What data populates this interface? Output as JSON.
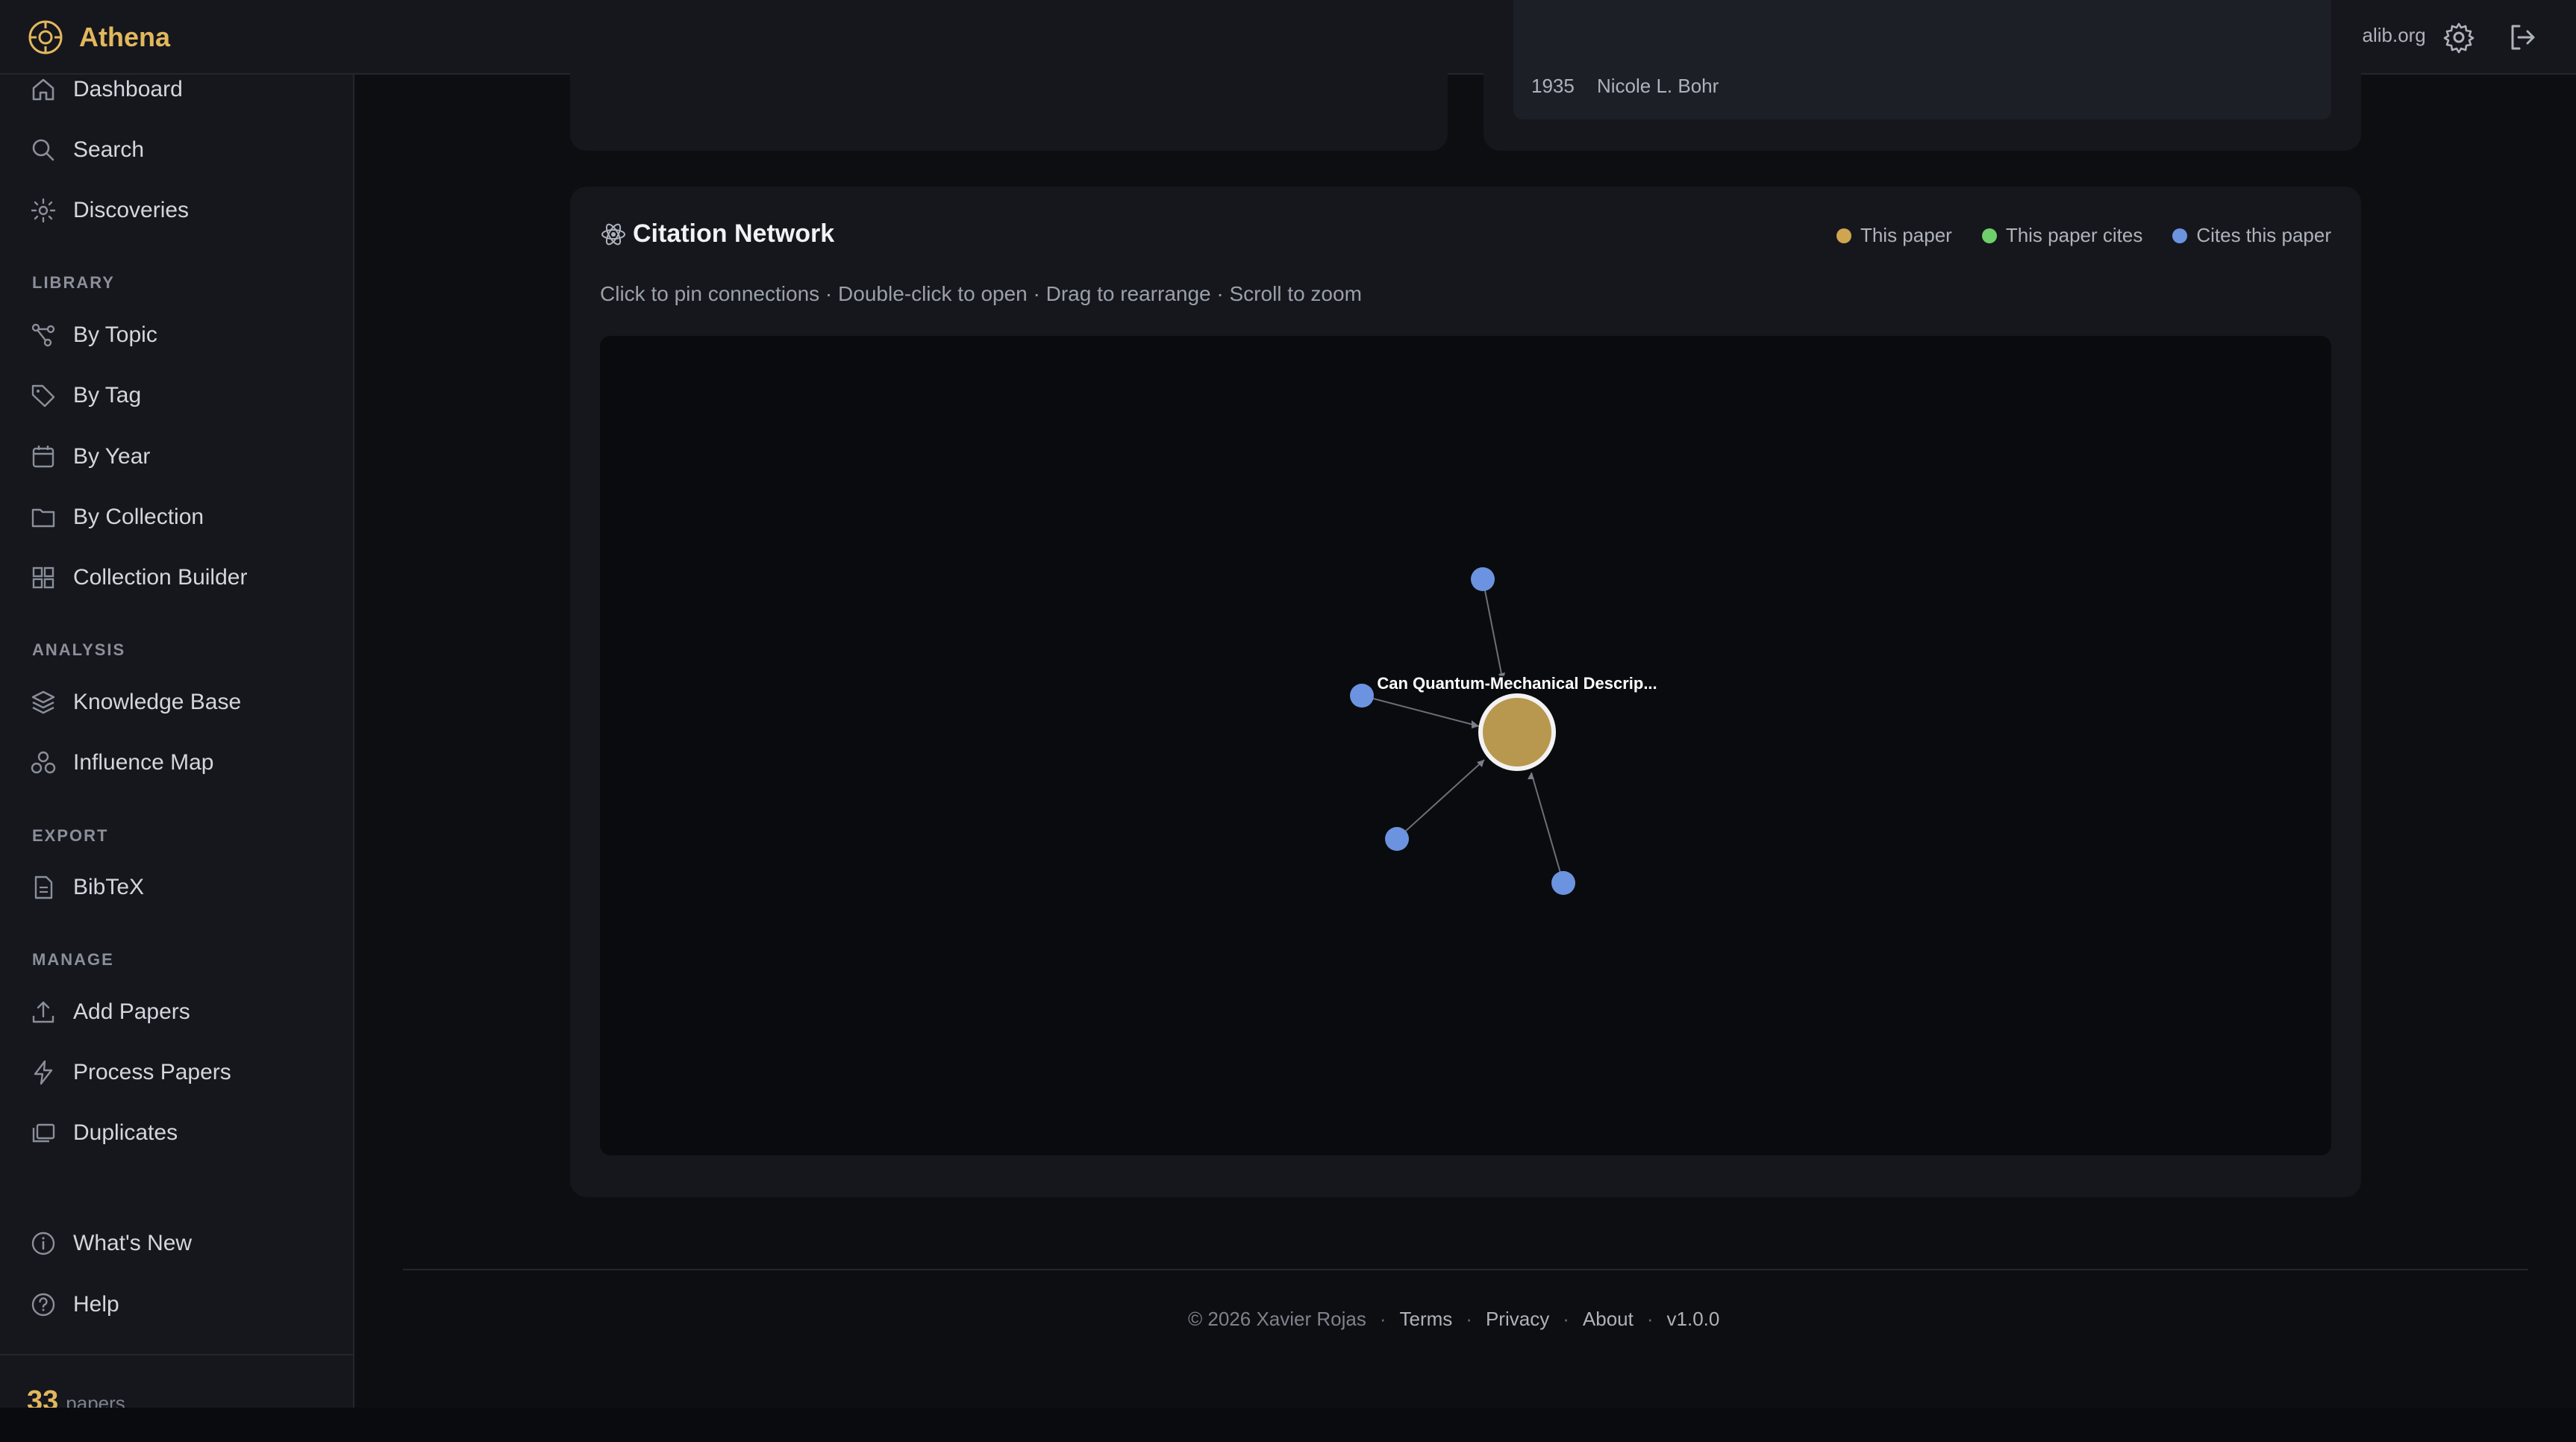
{
  "app": {
    "name": "Athena",
    "accent": "#e2b75d"
  },
  "topbar": {
    "user_email": "demo@athenalib.org"
  },
  "sidebar": {
    "main_items": [
      {
        "label": "Dashboard",
        "icon": "home-icon"
      },
      {
        "label": "Search",
        "icon": "search-icon"
      },
      {
        "label": "Discoveries",
        "icon": "sparkle-icon"
      }
    ],
    "sections": [
      {
        "title": "LIBRARY",
        "items": [
          {
            "label": "By Topic",
            "icon": "topic-graph-icon"
          },
          {
            "label": "By Tag",
            "icon": "tag-icon"
          },
          {
            "label": "By Year",
            "icon": "calendar-icon"
          },
          {
            "label": "By Collection",
            "icon": "folder-icon"
          },
          {
            "label": "Collection Builder",
            "icon": "grid-icon"
          }
        ]
      },
      {
        "title": "ANALYSIS",
        "items": [
          {
            "label": "Knowledge Base",
            "icon": "layers-icon"
          },
          {
            "label": "Influence Map",
            "icon": "influence-icon"
          }
        ]
      },
      {
        "title": "EXPORT",
        "items": [
          {
            "label": "BibTeX",
            "icon": "file-icon"
          }
        ]
      },
      {
        "title": "MANAGE",
        "items": [
          {
            "label": "Add Papers",
            "icon": "upload-icon"
          },
          {
            "label": "Process Papers",
            "icon": "bolt-icon"
          },
          {
            "label": "Duplicates",
            "icon": "duplicates-icon"
          }
        ]
      }
    ],
    "bottom_items": [
      {
        "label": "What's New",
        "icon": "info-icon"
      },
      {
        "label": "Help",
        "icon": "help-icon"
      }
    ],
    "paper_count": "33",
    "paper_count_unit": "papers"
  },
  "previous_card": {
    "year": "1935",
    "author": "Nicole L. Bohr"
  },
  "citation_network": {
    "title": "Citation Network",
    "hint": "Click to pin connections · Double-click to open · Drag to rearrange · Scroll to zoom",
    "legend": [
      {
        "label": "This paper",
        "color": "#cfa54f"
      },
      {
        "label": "This paper cites",
        "color": "#6fcf6a"
      },
      {
        "label": "Cites this paper",
        "color": "#6b93e0"
      }
    ],
    "center_node": {
      "label": "Can Quantum-Mechanical Descrip...",
      "color": "#b8974f"
    },
    "citing_nodes": 4,
    "citing_color": "#6b93e0"
  },
  "footer": {
    "copyright": "© 2026 Xavier Rojas",
    "links": [
      "Terms",
      "Privacy",
      "About"
    ],
    "version": "v1.0.0"
  }
}
